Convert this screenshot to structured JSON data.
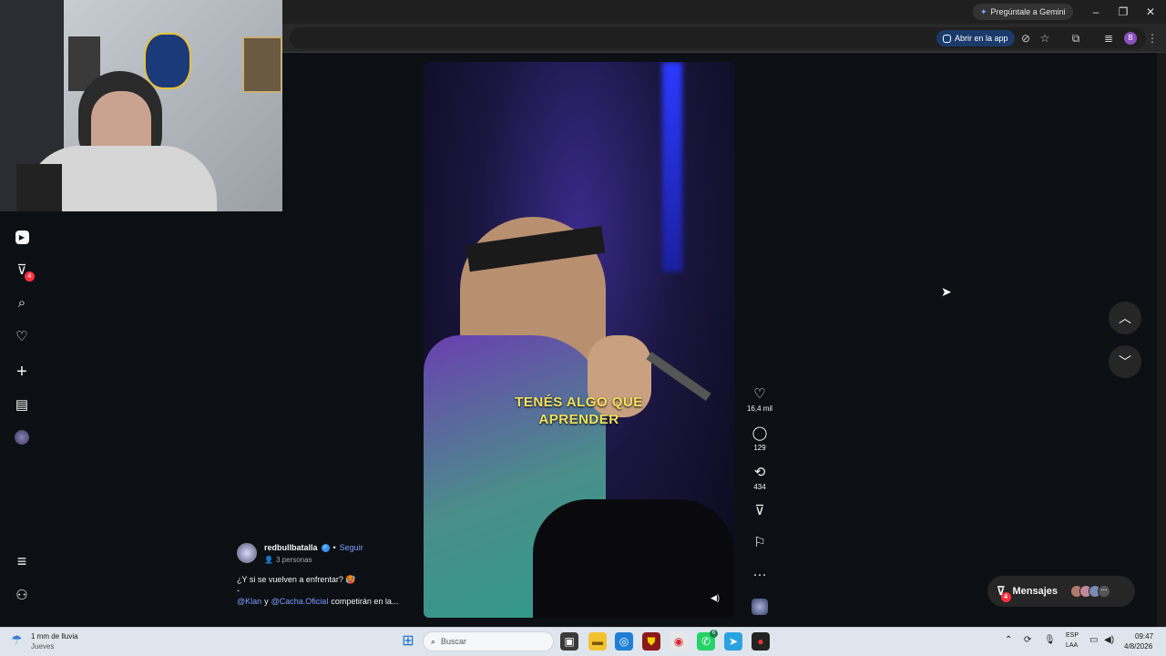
{
  "browser": {
    "gemini_label": "Pregúntale a Gemini",
    "open_app_label": "Abrir en la app",
    "profile_initial": "B",
    "minimize": "–",
    "restore": "❐",
    "close": "✕"
  },
  "sidebar": {
    "items": [
      {
        "name": "reels",
        "icon": "▶"
      },
      {
        "name": "messages",
        "icon": "✈",
        "badge": "4"
      },
      {
        "name": "search",
        "icon": "⌕"
      },
      {
        "name": "notifications",
        "icon": "♡"
      },
      {
        "name": "create",
        "icon": "+"
      },
      {
        "name": "dashboard",
        "icon": "▤"
      },
      {
        "name": "profile",
        "icon": "◉"
      }
    ],
    "menu_icon": "≡",
    "also_from_meta_icon": "⚇"
  },
  "video": {
    "caption_line1": "TENÉS ALGO QUE",
    "caption_line2": "APRENDER",
    "mute_icon": "🔈"
  },
  "actions": {
    "likes": "16,4 mil",
    "comments": "129",
    "reposts": "434",
    "more": "···"
  },
  "post": {
    "username": "redbullbatalla",
    "follow": "Seguir",
    "separator": "•",
    "audience": "3 personas",
    "caption": "¿Y si se vuelven a enfrentar? 🥵",
    "dash": "-",
    "mention1": "@Klan",
    "conj": "y",
    "mention2": "@Cacha.Oficial",
    "caption_rest": "competirán en la..."
  },
  "messages": {
    "label": "Mensajes",
    "badge": "4"
  },
  "taskbar": {
    "weather_line1": "1 mm de lluvia",
    "weather_line2": "Jueves",
    "search_placeholder": "Buscar",
    "lang_line1": "ESP",
    "lang_line2": "LAA",
    "time": "09:47",
    "date": "4/8/2026",
    "whatsapp_badge": "6"
  },
  "colors": {
    "background": "#0c1014",
    "accent_link": "#7c9cff",
    "badge": "#ff3040",
    "caption_yellow": "#f2e15a"
  }
}
